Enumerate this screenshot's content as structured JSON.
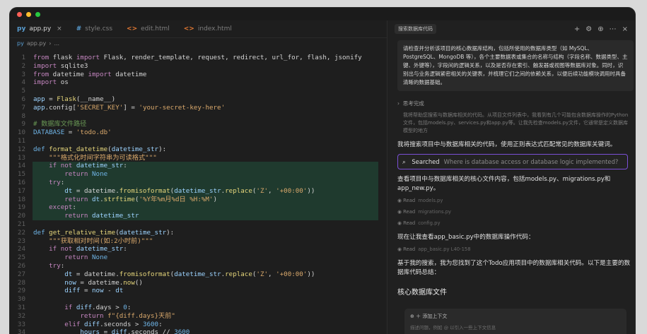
{
  "window": {
    "traffic_colors": [
      "#ff5f57",
      "#febc2e",
      "#28c840"
    ]
  },
  "tabs": [
    {
      "icon": "py",
      "label": "app.py",
      "active": true,
      "icon_color": "#5a9fd4"
    },
    {
      "icon": "#",
      "label": "style.css",
      "active": false,
      "icon_color": "#5a9fd4"
    },
    {
      "icon": "<>",
      "label": "edit.html",
      "active": false,
      "icon_color": "#e37933"
    },
    {
      "icon": "<>",
      "label": "index.html",
      "active": false,
      "icon_color": "#e37933"
    }
  ],
  "breadcrumb": {
    "file": "app.py",
    "sep": "›",
    "item": "..."
  },
  "code": {
    "lines": [
      {
        "n": "1",
        "html": "<span class='kw2'>from</span> flask <span class='kw2'>import</span> Flask, render_template, request, redirect, url_for, flash, jsonify"
      },
      {
        "n": "2",
        "html": "<span class='kw2'>import</span> sqlite3"
      },
      {
        "n": "3",
        "html": "<span class='kw2'>from</span> datetime <span class='kw2'>import</span> datetime"
      },
      {
        "n": "4",
        "html": "<span class='kw2'>import</span> os"
      },
      {
        "n": "5",
        "html": ""
      },
      {
        "n": "6",
        "html": "<span class='v'>app</span> = <span class='f'>Flask</span>(__name__)"
      },
      {
        "n": "7",
        "html": "<span class='v'>app</span>.config[<span class='s'>'SECRET_KEY'</span>] = <span class='s'>'your-secret-key-here'</span>"
      },
      {
        "n": "8",
        "html": ""
      },
      {
        "n": "9",
        "html": "<span class='c'># 数据库文件路径</span>"
      },
      {
        "n": "10",
        "html": "<span class='b'>DATABASE</span> = <span class='s'>'todo.db'</span>"
      },
      {
        "n": "11",
        "html": ""
      },
      {
        "n": "12",
        "html": "<span class='b'>def</span> <span class='f'>format_datetime</span>(<span class='v'>datetime_str</span>):"
      },
      {
        "n": "13",
        "html": "    <span class='s'>\"\"\"格式化时间字符串为可读格式\"\"\"</span>"
      },
      {
        "n": "14",
        "html": "    <span class='kw2'>if not</span> <span class='v'>datetime_str</span>:",
        "hl": true
      },
      {
        "n": "15",
        "html": "        <span class='kw2'>return</span> <span class='b'>None</span>",
        "hl": true
      },
      {
        "n": "16",
        "html": "    <span class='kw2'>try</span>:",
        "hl": true
      },
      {
        "n": "17",
        "html": "        <span class='v'>dt</span> = datetime.<span class='f'>fromisoformat</span>(<span class='v'>datetime_str</span>.<span class='f'>replace</span>(<span class='s'>'Z'</span>, <span class='s'>'+00:00'</span>))",
        "hl": true
      },
      {
        "n": "18",
        "html": "        <span class='kw2'>return</span> <span class='v'>dt</span>.<span class='f'>strftime</span>(<span class='s'>'%Y年%m月%d日 %H:%M'</span>)",
        "hl": true
      },
      {
        "n": "19",
        "html": "    <span class='kw2'>except</span>:",
        "hl": true
      },
      {
        "n": "20",
        "html": "        <span class='kw2'>return</span> <span class='v'>datetime_str</span>",
        "hl": true
      },
      {
        "n": "21",
        "html": ""
      },
      {
        "n": "22",
        "html": "<span class='b'>def</span> <span class='f'>get_relative_time</span>(<span class='v'>datetime_str</span>):"
      },
      {
        "n": "23",
        "html": "    <span class='s'>\"\"\"获取相对时间(如:2小时前)\"\"\"</span>"
      },
      {
        "n": "24",
        "html": "    <span class='kw2'>if not</span> <span class='v'>datetime_str</span>:"
      },
      {
        "n": "25",
        "html": "        <span class='kw2'>return</span> <span class='b'>None</span>"
      },
      {
        "n": "26",
        "html": "    <span class='kw2'>try</span>:"
      },
      {
        "n": "27",
        "html": "        <span class='v'>dt</span> = datetime.<span class='f'>fromisoformat</span>(<span class='v'>datetime_str</span>.<span class='f'>replace</span>(<span class='s'>'Z'</span>, <span class='s'>'+00:00'</span>))"
      },
      {
        "n": "28",
        "html": "        <span class='v'>now</span> = datetime.<span class='f'>now</span>()"
      },
      {
        "n": "29",
        "html": "        <span class='v'>diff</span> = <span class='v'>now</span> - <span class='v'>dt</span>"
      },
      {
        "n": "30",
        "html": ""
      },
      {
        "n": "31",
        "html": "        <span class='kw2'>if</span> <span class='v'>diff</span>.days &gt; <span class='b'>0</span>:"
      },
      {
        "n": "32",
        "html": "            <span class='kw2'>return</span> <span class='s'>f\"{diff.days}天前\"</span>"
      },
      {
        "n": "33",
        "html": "        <span class='kw2'>elif</span> <span class='v'>diff</span>.seconds &gt; <span class='b'>3600</span>:"
      },
      {
        "n": "34",
        "html": "            <span class='v'>hours</span> = <span class='v'>diff</span>.seconds // <span class='b'>3600</span>"
      }
    ]
  },
  "panel": {
    "title": "搜索数据库代码",
    "actions": [
      "+",
      "⚙",
      "⊕",
      "⋯",
      "×"
    ],
    "user_message": "请检查并分析该项目的核心数据库结构，包括所使用的数据库类型（如 MySQL、PostgreSQL、MongoDB 等），各个主要数据表或集合的名称与结构（字段名称、数据类型、主键、外键等），字段间的逻辑关系，以及是否存在索引、触发器或视图等数据库对象。同时，识别出与业务逻辑紧密相关的关键表，并梳理它们之间的依赖关系，以便后续功能模块调用时具备清晰的数据基础。",
    "thought_label": "思考完成",
    "thought_body": "我将帮助您搜索与数据库相关的代码。从项目文件列表中，我看到有几个可能包含数据库操作的Python文件，包括models.py、services.py和app.py等。让我先检查models.py文件，它通常是定义数据库模型的地方",
    "msg1": "我将搜索项目中与数据库相关的代码，使用正则表达式匹配常见的数据库关键词。",
    "search_label": "Searched",
    "search_query": "Where is database access or database logic implemented?",
    "msg2": "查看项目中与数据库相关的核心文件内容，包括models.py、migrations.py和app_new.py。",
    "reads": [
      {
        "label": "Read",
        "file": "models.py"
      },
      {
        "label": "Read",
        "file": "migrations.py"
      },
      {
        "label": "Read",
        "file": "config.py"
      }
    ],
    "msg3": "现在让我查看app_basic.py中的数据库操作代码：",
    "read4": {
      "label": "Read",
      "file": "app_basic.py L40-158"
    },
    "msg4": "基于我的搜索，我为您找到了这个Todo应用项目中的数据库相关代码。以下是主要的数据库代码总结：",
    "heading": "核心数据库文件",
    "input_ctx": "⊕  ＋ 添加上下文",
    "input_placeholder": "描述问题，例如 @ 以引入一些上下文信息"
  }
}
